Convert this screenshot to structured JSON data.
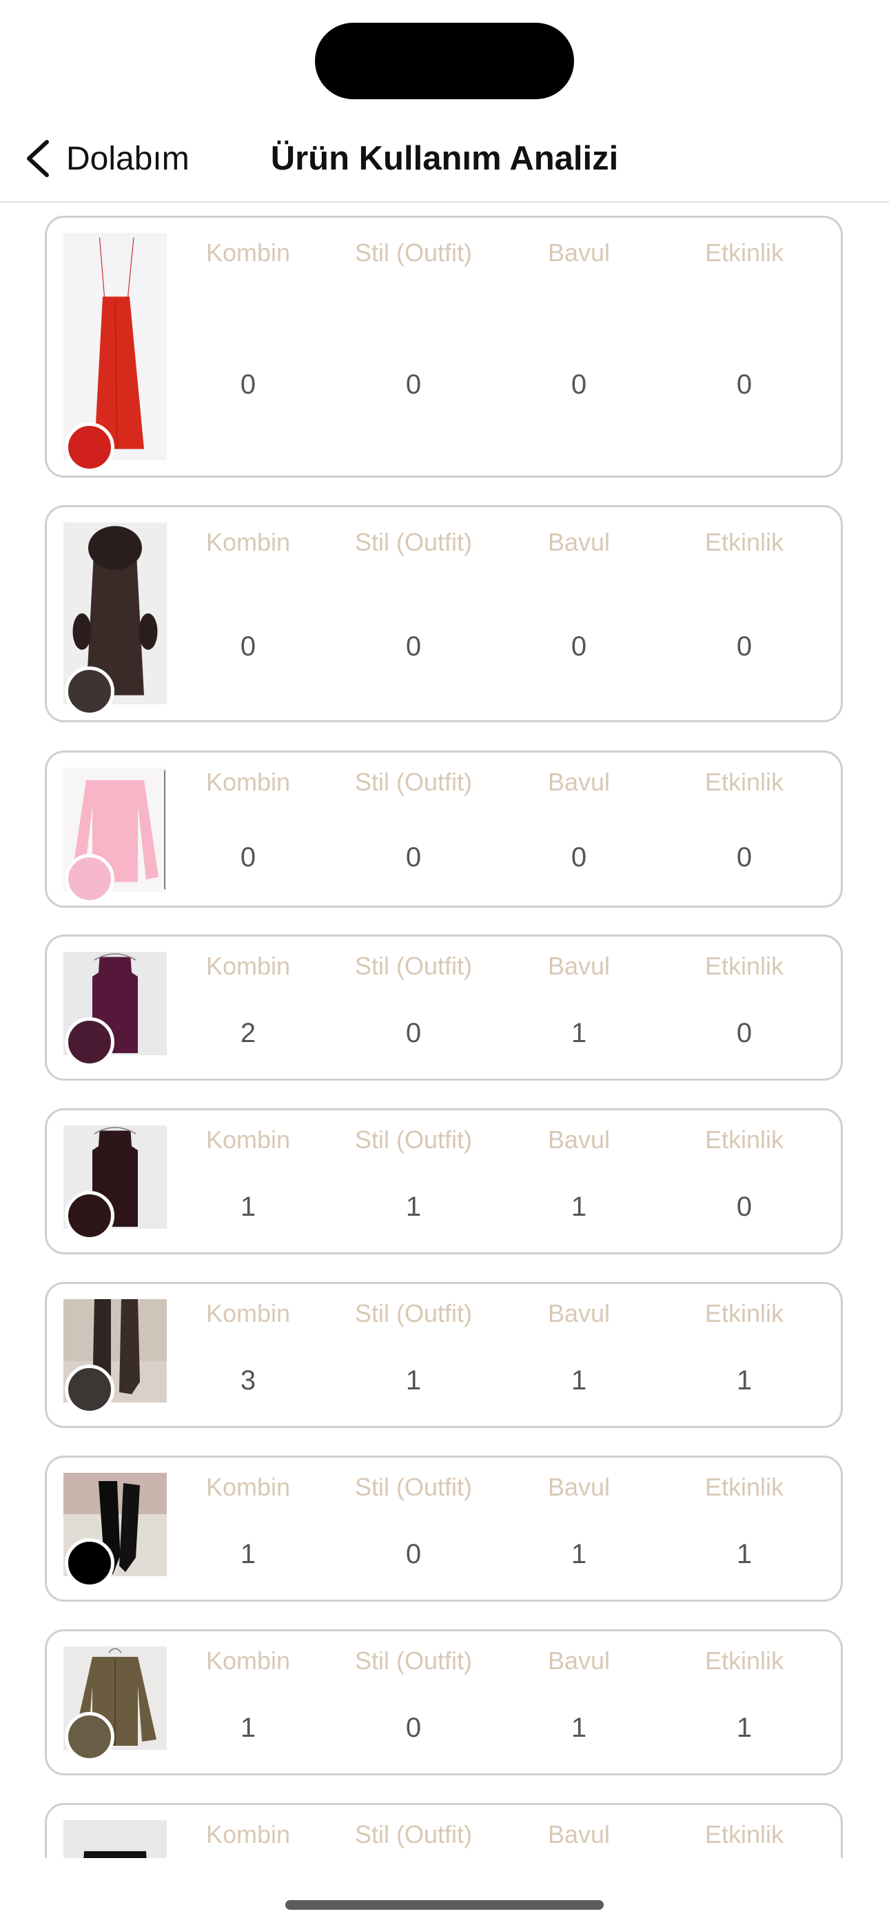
{
  "header": {
    "back_label": "Dolabım",
    "title": "Ürün Kullanım Analizi"
  },
  "columns": [
    "Kombin",
    "Stil (Outfit)",
    "Bavul",
    "Etkinlik"
  ],
  "items": [
    {
      "garment": "red-slip-dress",
      "color": "#d0211c",
      "values": [
        "0",
        "0",
        "0",
        "0"
      ]
    },
    {
      "garment": "fur-trim-leather-coat",
      "color": "#3e3533",
      "values": [
        "0",
        "0",
        "0",
        "0"
      ]
    },
    {
      "garment": "pink-knit-sweater",
      "color": "#f5b9cb",
      "values": [
        "0",
        "0",
        "0",
        "0"
      ]
    },
    {
      "garment": "plum-sleeveless-top",
      "color": "#4a1a33",
      "values": [
        "2",
        "0",
        "1",
        "0"
      ]
    },
    {
      "garment": "dark-sleeveless-top",
      "color": "#2c1618",
      "values": [
        "1",
        "1",
        "1",
        "0"
      ]
    },
    {
      "garment": "brown-boots",
      "color": "#3c3634",
      "values": [
        "3",
        "1",
        "1",
        "1"
      ]
    },
    {
      "garment": "black-boots",
      "color": "#000000",
      "values": [
        "1",
        "0",
        "1",
        "1"
      ]
    },
    {
      "garment": "olive-cardigan",
      "color": "#6a5d45",
      "values": [
        "1",
        "0",
        "1",
        "1"
      ]
    },
    {
      "garment": "black-trousers",
      "color": "#111111",
      "values": [
        "",
        "",
        "",
        ""
      ]
    }
  ]
}
